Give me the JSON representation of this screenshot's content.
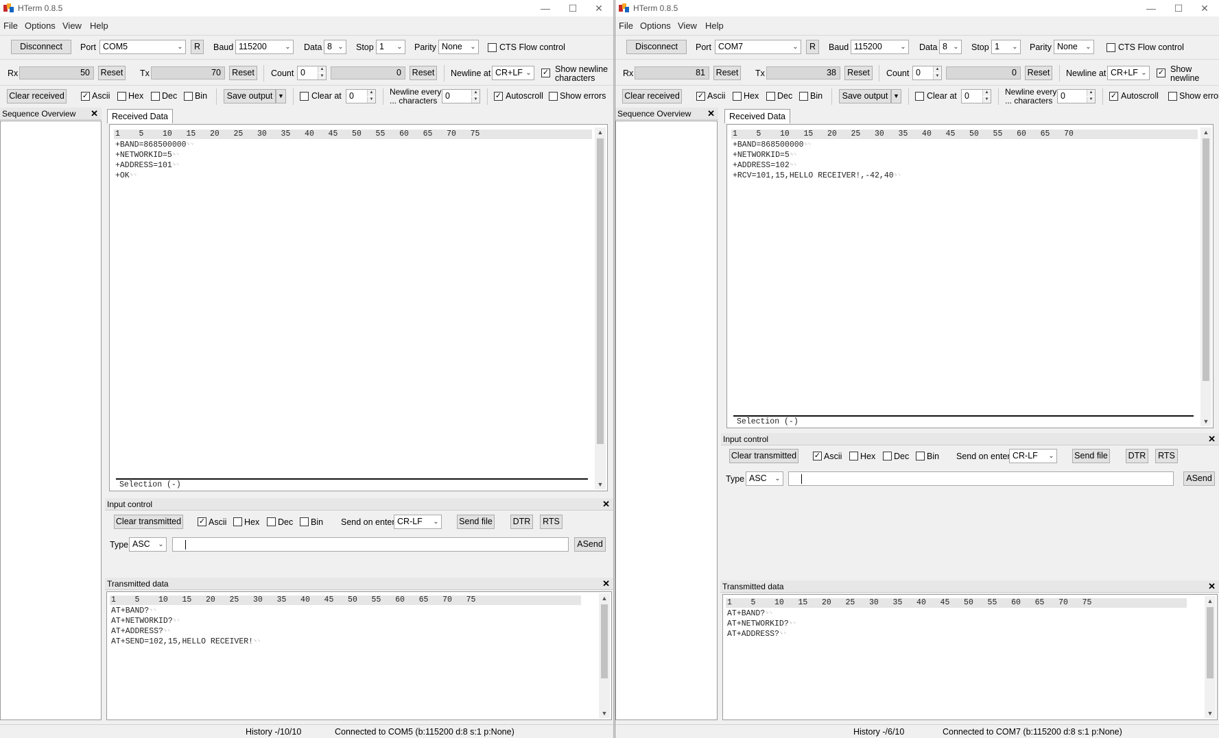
{
  "windows": [
    {
      "title": "HTerm 0.8.5",
      "menu": [
        "File",
        "Options",
        "View",
        "Help"
      ],
      "toolbar1": {
        "disconnect": "Disconnect",
        "port_label": "Port",
        "port_value": "COM5",
        "r_button": "R",
        "baud_label": "Baud",
        "baud_value": "115200",
        "data_label": "Data",
        "data_value": "8",
        "stop_label": "Stop",
        "stop_value": "1",
        "parity_label": "Parity",
        "parity_value": "None",
        "cts_label": "CTS Flow control"
      },
      "toolbar2": {
        "rx_label": "Rx",
        "rx_value": "50",
        "rx_reset": "Reset",
        "tx_label": "Tx",
        "tx_value": "70",
        "tx_reset": "Reset",
        "count_label": "Count",
        "count_value": "0",
        "count_display": "0",
        "count_reset": "Reset",
        "newline_at_label": "Newline at",
        "newline_at_value": "CR+LF",
        "show_newline_label_1": "Show newline",
        "show_newline_label_2": "characters"
      },
      "toolbar3": {
        "clear_received": "Clear received",
        "ascii": "Ascii",
        "hex": "Hex",
        "dec": "Dec",
        "bin": "Bin",
        "save_output": "Save output",
        "clear_at": "Clear at",
        "clear_at_value": "0",
        "newline_every_1": "Newline every",
        "newline_every_2": "... characters",
        "newline_every_value": "0",
        "autoscroll": "Autoscroll",
        "show_errors": "Show errors"
      },
      "sequence_overview": "Sequence Overview",
      "received_tab": "Received Data",
      "received_ruler": "1    5    10   15   20   25   30   35   40   45   50   55   60   65   70   75",
      "received_lines": [
        "+BAND=868500000",
        "+NETWORKID=5",
        "+ADDRESS=101",
        "+OK"
      ],
      "selection": "Selection (-)",
      "input_control": {
        "title": "Input control",
        "clear_transmitted": "Clear transmitted",
        "ascii": "Ascii",
        "hex": "Hex",
        "dec": "Dec",
        "bin": "Bin",
        "send_on_enter_label": "Send on enter",
        "send_on_enter_value": "CR-LF",
        "send_file": "Send file",
        "dtr": "DTR",
        "rts": "RTS",
        "type_label": "Type",
        "type_value": "ASC",
        "input_value": "",
        "asend": "ASend"
      },
      "transmitted": {
        "title": "Transmitted data",
        "ruler": "1    5    10   15   20   25   30   35   40   45   50   55   60   65   70   75",
        "lines": [
          "AT+BAND?",
          "AT+NETWORKID?",
          "AT+ADDRESS?",
          "AT+SEND=102,15,HELLO RECEIVER!"
        ]
      },
      "status": {
        "history": "History -/10/10",
        "connection": "Connected to COM5 (b:115200 d:8 s:1 p:None)"
      },
      "checks": {
        "cts": false,
        "show_newline": true,
        "ascii": true,
        "hex": false,
        "dec": false,
        "bin": false,
        "clear_at": false,
        "autoscroll": true,
        "show_errors": false,
        "in_ascii": true,
        "in_hex": false,
        "in_dec": false,
        "in_bin": false
      }
    },
    {
      "title": "HTerm 0.8.5",
      "menu": [
        "File",
        "Options",
        "View",
        "Help"
      ],
      "toolbar1": {
        "disconnect": "Disconnect",
        "port_label": "Port",
        "port_value": "COM7",
        "r_button": "R",
        "baud_label": "Baud",
        "baud_value": "115200",
        "data_label": "Data",
        "data_value": "8",
        "stop_label": "Stop",
        "stop_value": "1",
        "parity_label": "Parity",
        "parity_value": "None",
        "cts_label": "CTS Flow control"
      },
      "toolbar2": {
        "rx_label": "Rx",
        "rx_value": "81",
        "rx_reset": "Reset",
        "tx_label": "Tx",
        "tx_value": "38",
        "tx_reset": "Reset",
        "count_label": "Count",
        "count_value": "0",
        "count_display": "0",
        "count_reset": "Reset",
        "newline_at_label": "Newline at",
        "newline_at_value": "CR+LF",
        "show_newline_label_1": "Show",
        "show_newline_label_2": "newline"
      },
      "toolbar3": {
        "clear_received": "Clear received",
        "ascii": "Ascii",
        "hex": "Hex",
        "dec": "Dec",
        "bin": "Bin",
        "save_output": "Save output",
        "clear_at": "Clear at",
        "clear_at_value": "0",
        "newline_every_1": "Newline every",
        "newline_every_2": "... characters",
        "newline_every_value": "0",
        "autoscroll": "Autoscroll",
        "show_errors": "Show errors"
      },
      "sequence_overview": "Sequence Overview",
      "received_tab": "Received Data",
      "received_ruler": "1    5    10   15   20   25   30   35   40   45   50   55   60   65   70",
      "received_lines": [
        "+BAND=868500000",
        "+NETWORKID=5",
        "+ADDRESS=102",
        "+RCV=101,15,HELLO RECEIVER!,-42,40"
      ],
      "selection": "Selection (-)",
      "input_control": {
        "title": "Input control",
        "clear_transmitted": "Clear transmitted",
        "ascii": "Ascii",
        "hex": "Hex",
        "dec": "Dec",
        "bin": "Bin",
        "send_on_enter_label": "Send on enter",
        "send_on_enter_value": "CR-LF",
        "send_file": "Send file",
        "dtr": "DTR",
        "rts": "RTS",
        "type_label": "Type",
        "type_value": "ASC",
        "input_value": "",
        "asend": "ASend"
      },
      "transmitted": {
        "title": "Transmitted data",
        "ruler": "1    5    10   15   20   25   30   35   40   45   50   55   60   65   70   75",
        "lines": [
          "AT+BAND?",
          "AT+NETWORKID?",
          "AT+ADDRESS?"
        ]
      },
      "status": {
        "history": "History -/6/10",
        "connection": "Connected to COM7 (b:115200 d:8 s:1 p:None)"
      },
      "checks": {
        "cts": false,
        "show_newline": true,
        "ascii": true,
        "hex": false,
        "dec": false,
        "bin": false,
        "clear_at": false,
        "autoscroll": true,
        "show_errors": false,
        "in_ascii": true,
        "in_hex": false,
        "in_dec": false,
        "in_bin": false
      }
    }
  ],
  "crlf_marker": "␍␊",
  "icons": {
    "app": "hterm-icon",
    "minimize": "minimize-icon",
    "maximize": "maximize-icon",
    "close": "close-icon",
    "dropdown": "chevron-down-icon"
  }
}
